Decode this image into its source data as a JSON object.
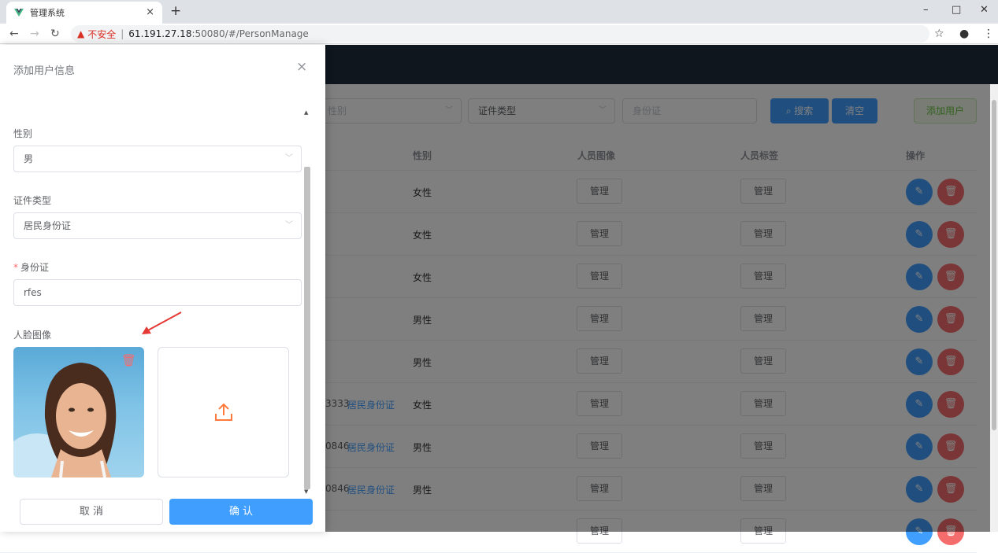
{
  "browser": {
    "tab_title": "管理系统",
    "tab_close": "×",
    "new_tab": "+",
    "insecure_label": "不安全",
    "url_separator": "|",
    "url_host": "61.191.27.18",
    "url_path": ":50080/#/PersonManage",
    "window": {
      "minimize": "–",
      "maximize": "□",
      "close": "✕"
    }
  },
  "filters": {
    "gender_placeholder": "性别",
    "id_type_placeholder": "证件类型",
    "id_placeholder": "身份证",
    "search_button": "搜索",
    "clear_button": "清空",
    "add_button": "添加用户"
  },
  "table": {
    "headers": [
      "性别",
      "人员图像",
      "人员标签",
      "操作"
    ],
    "manage_label": "管理",
    "rows": [
      {
        "id_tail": "",
        "id_type": "",
        "gender": "女性"
      },
      {
        "id_tail": "",
        "id_type": "",
        "gender": "女性"
      },
      {
        "id_tail": "",
        "id_type": "",
        "gender": "女性"
      },
      {
        "id_tail": "",
        "id_type": "",
        "gender": "男性"
      },
      {
        "id_tail": "",
        "id_type": "",
        "gender": "男性"
      },
      {
        "id_tail": "3333",
        "id_type": "居民身份证",
        "gender": "女性"
      },
      {
        "id_tail": "0846",
        "id_type": "居民身份证",
        "gender": "男性"
      },
      {
        "id_tail": "0846",
        "id_type": "居民身份证",
        "gender": "男性"
      },
      {
        "id_tail": "",
        "id_type": "",
        "gender": ""
      }
    ]
  },
  "drawer": {
    "title": "添加用户信息",
    "close": "×",
    "gender_label": "性别",
    "gender_value": "男",
    "id_type_label": "证件类型",
    "id_type_value": "居民身份证",
    "id_required_mark": "*",
    "id_label": "身份证",
    "id_value": "rfes",
    "face_label": "人脸图像",
    "cancel_button": "取 消",
    "confirm_button": "确 认"
  },
  "colors": {
    "primary": "#409eff",
    "danger": "#f56c6c",
    "success": "#67c23a",
    "header": "#1f2d3d"
  }
}
